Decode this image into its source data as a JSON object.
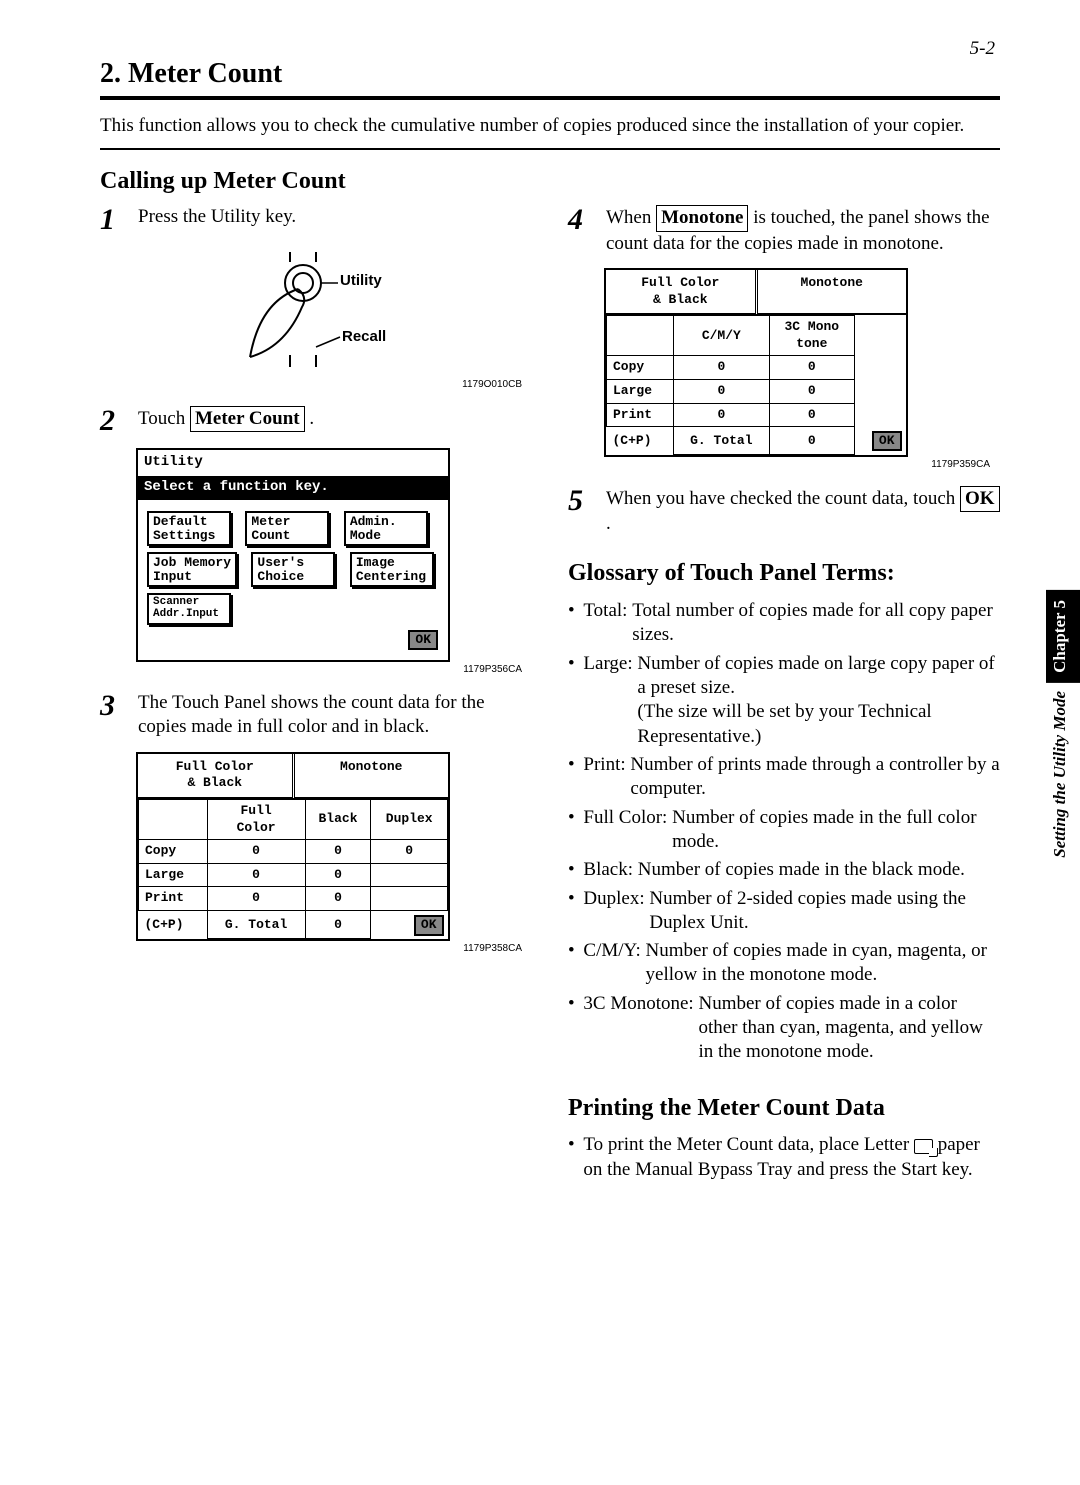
{
  "page_number": "5-2",
  "section_number": "2.",
  "section_title": "Meter Count",
  "intro": "This function allows you to check the cumulative number of copies produced since the installation of your copier.",
  "sub1": "Calling up Meter Count",
  "steps": {
    "s1": "Press the Utility key.",
    "s2a": "Touch ",
    "s2b": "Meter Count",
    "s2c": " .",
    "s3": "The Touch Panel shows the count data for the copies made in full color and in black.",
    "s4a": "When ",
    "s4b": "Monotone",
    "s4c": " is touched, the panel shows the count data for the copies made in monotone.",
    "s5a": "When you have checked the count data, touch ",
    "s5b": "OK",
    "s5c": " ."
  },
  "handlabels": {
    "utility": "Utility",
    "recall": "Recall"
  },
  "figcodes": {
    "a": "1179O010CB",
    "b": "1179P356CA",
    "c": "1179P358CA",
    "d": "1179P359CA"
  },
  "panel1": {
    "title": "Utility",
    "prompt": "Select a function key.",
    "btns": [
      "Default\nSettings",
      "Meter\nCount",
      "Admin.\nMode",
      "Job Memory\nInput",
      "User's\nChoice",
      "Image\nCentering",
      "Scanner\nAddr.Input"
    ],
    "ok": "OK"
  },
  "table3": {
    "tab1": "Full Color\n& Black",
    "tab2": "Monotone",
    "cols": [
      "",
      "Full\nColor",
      "Black",
      "Duplex"
    ],
    "rows": [
      [
        "Copy",
        "0",
        "0",
        "0"
      ],
      [
        "Large",
        "0",
        "0",
        ""
      ],
      [
        "Print",
        "0",
        "0",
        ""
      ]
    ],
    "cp": "(C+P)",
    "gt": "G. Total",
    "gtval": "0",
    "ok": "OK"
  },
  "table4": {
    "tab1": "Full Color\n& Black",
    "tab2": "Monotone",
    "cols": [
      "",
      "C/M/Y",
      "3C Mono\ntone"
    ],
    "rows": [
      [
        "Copy",
        "0",
        "0"
      ],
      [
        "Large",
        "0",
        "0"
      ],
      [
        "Print",
        "0",
        "0"
      ]
    ],
    "cp": "(C+P)",
    "gt": "G. Total",
    "gtval": "0",
    "ok": "OK"
  },
  "glossary_head": "Glossary of Touch Panel Terms:",
  "glossary": [
    {
      "t": "Total:",
      "d": "Total number of copies made for all copy paper sizes."
    },
    {
      "t": "Large:",
      "d": "Number of copies made on large copy paper of a preset size.\n(The size will be set by your Technical Representative.)"
    },
    {
      "t": "Print:",
      "d": "Number of prints made through a controller by a computer."
    },
    {
      "t": "Full Color:",
      "d": "Number of copies made in the full color mode."
    },
    {
      "t": "Black:",
      "d": "Number of copies made in the black mode."
    },
    {
      "t": "Duplex:",
      "d": "Number of 2-sided copies made using the Duplex Unit."
    },
    {
      "t": "C/M/Y:",
      "d": "Number of copies made in cyan, magenta, or yellow in the monotone mode."
    },
    {
      "t": "3C Monotone:",
      "d": "Number of copies made in a color other than cyan, magenta, and yellow in the monotone mode."
    }
  ],
  "print_head": "Printing the Meter Count Data",
  "print_text_a": "To print the Meter Count data, place Letter ",
  "print_text_b": " paper on the Manual Bypass Tray and press the Start key.",
  "sidetab": {
    "chapter": "Chapter 5",
    "mode": "Setting the Utility Mode"
  }
}
